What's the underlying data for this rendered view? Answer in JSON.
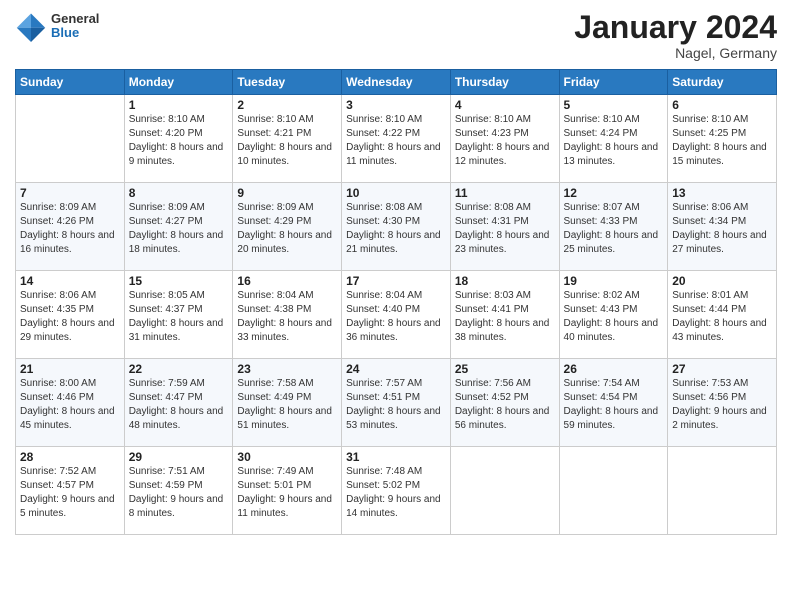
{
  "logo": {
    "general": "General",
    "blue": "Blue"
  },
  "title": "January 2024",
  "location": "Nagel, Germany",
  "days_header": [
    "Sunday",
    "Monday",
    "Tuesday",
    "Wednesday",
    "Thursday",
    "Friday",
    "Saturday"
  ],
  "weeks": [
    [
      {
        "day": "",
        "sunrise": "",
        "sunset": "",
        "daylight": ""
      },
      {
        "day": "1",
        "sunrise": "Sunrise: 8:10 AM",
        "sunset": "Sunset: 4:20 PM",
        "daylight": "Daylight: 8 hours and 9 minutes."
      },
      {
        "day": "2",
        "sunrise": "Sunrise: 8:10 AM",
        "sunset": "Sunset: 4:21 PM",
        "daylight": "Daylight: 8 hours and 10 minutes."
      },
      {
        "day": "3",
        "sunrise": "Sunrise: 8:10 AM",
        "sunset": "Sunset: 4:22 PM",
        "daylight": "Daylight: 8 hours and 11 minutes."
      },
      {
        "day": "4",
        "sunrise": "Sunrise: 8:10 AM",
        "sunset": "Sunset: 4:23 PM",
        "daylight": "Daylight: 8 hours and 12 minutes."
      },
      {
        "day": "5",
        "sunrise": "Sunrise: 8:10 AM",
        "sunset": "Sunset: 4:24 PM",
        "daylight": "Daylight: 8 hours and 13 minutes."
      },
      {
        "day": "6",
        "sunrise": "Sunrise: 8:10 AM",
        "sunset": "Sunset: 4:25 PM",
        "daylight": "Daylight: 8 hours and 15 minutes."
      }
    ],
    [
      {
        "day": "7",
        "sunrise": "Sunrise: 8:09 AM",
        "sunset": "Sunset: 4:26 PM",
        "daylight": "Daylight: 8 hours and 16 minutes."
      },
      {
        "day": "8",
        "sunrise": "Sunrise: 8:09 AM",
        "sunset": "Sunset: 4:27 PM",
        "daylight": "Daylight: 8 hours and 18 minutes."
      },
      {
        "day": "9",
        "sunrise": "Sunrise: 8:09 AM",
        "sunset": "Sunset: 4:29 PM",
        "daylight": "Daylight: 8 hours and 20 minutes."
      },
      {
        "day": "10",
        "sunrise": "Sunrise: 8:08 AM",
        "sunset": "Sunset: 4:30 PM",
        "daylight": "Daylight: 8 hours and 21 minutes."
      },
      {
        "day": "11",
        "sunrise": "Sunrise: 8:08 AM",
        "sunset": "Sunset: 4:31 PM",
        "daylight": "Daylight: 8 hours and 23 minutes."
      },
      {
        "day": "12",
        "sunrise": "Sunrise: 8:07 AM",
        "sunset": "Sunset: 4:33 PM",
        "daylight": "Daylight: 8 hours and 25 minutes."
      },
      {
        "day": "13",
        "sunrise": "Sunrise: 8:06 AM",
        "sunset": "Sunset: 4:34 PM",
        "daylight": "Daylight: 8 hours and 27 minutes."
      }
    ],
    [
      {
        "day": "14",
        "sunrise": "Sunrise: 8:06 AM",
        "sunset": "Sunset: 4:35 PM",
        "daylight": "Daylight: 8 hours and 29 minutes."
      },
      {
        "day": "15",
        "sunrise": "Sunrise: 8:05 AM",
        "sunset": "Sunset: 4:37 PM",
        "daylight": "Daylight: 8 hours and 31 minutes."
      },
      {
        "day": "16",
        "sunrise": "Sunrise: 8:04 AM",
        "sunset": "Sunset: 4:38 PM",
        "daylight": "Daylight: 8 hours and 33 minutes."
      },
      {
        "day": "17",
        "sunrise": "Sunrise: 8:04 AM",
        "sunset": "Sunset: 4:40 PM",
        "daylight": "Daylight: 8 hours and 36 minutes."
      },
      {
        "day": "18",
        "sunrise": "Sunrise: 8:03 AM",
        "sunset": "Sunset: 4:41 PM",
        "daylight": "Daylight: 8 hours and 38 minutes."
      },
      {
        "day": "19",
        "sunrise": "Sunrise: 8:02 AM",
        "sunset": "Sunset: 4:43 PM",
        "daylight": "Daylight: 8 hours and 40 minutes."
      },
      {
        "day": "20",
        "sunrise": "Sunrise: 8:01 AM",
        "sunset": "Sunset: 4:44 PM",
        "daylight": "Daylight: 8 hours and 43 minutes."
      }
    ],
    [
      {
        "day": "21",
        "sunrise": "Sunrise: 8:00 AM",
        "sunset": "Sunset: 4:46 PM",
        "daylight": "Daylight: 8 hours and 45 minutes."
      },
      {
        "day": "22",
        "sunrise": "Sunrise: 7:59 AM",
        "sunset": "Sunset: 4:47 PM",
        "daylight": "Daylight: 8 hours and 48 minutes."
      },
      {
        "day": "23",
        "sunrise": "Sunrise: 7:58 AM",
        "sunset": "Sunset: 4:49 PM",
        "daylight": "Daylight: 8 hours and 51 minutes."
      },
      {
        "day": "24",
        "sunrise": "Sunrise: 7:57 AM",
        "sunset": "Sunset: 4:51 PM",
        "daylight": "Daylight: 8 hours and 53 minutes."
      },
      {
        "day": "25",
        "sunrise": "Sunrise: 7:56 AM",
        "sunset": "Sunset: 4:52 PM",
        "daylight": "Daylight: 8 hours and 56 minutes."
      },
      {
        "day": "26",
        "sunrise": "Sunrise: 7:54 AM",
        "sunset": "Sunset: 4:54 PM",
        "daylight": "Daylight: 8 hours and 59 minutes."
      },
      {
        "day": "27",
        "sunrise": "Sunrise: 7:53 AM",
        "sunset": "Sunset: 4:56 PM",
        "daylight": "Daylight: 9 hours and 2 minutes."
      }
    ],
    [
      {
        "day": "28",
        "sunrise": "Sunrise: 7:52 AM",
        "sunset": "Sunset: 4:57 PM",
        "daylight": "Daylight: 9 hours and 5 minutes."
      },
      {
        "day": "29",
        "sunrise": "Sunrise: 7:51 AM",
        "sunset": "Sunset: 4:59 PM",
        "daylight": "Daylight: 9 hours and 8 minutes."
      },
      {
        "day": "30",
        "sunrise": "Sunrise: 7:49 AM",
        "sunset": "Sunset: 5:01 PM",
        "daylight": "Daylight: 9 hours and 11 minutes."
      },
      {
        "day": "31",
        "sunrise": "Sunrise: 7:48 AM",
        "sunset": "Sunset: 5:02 PM",
        "daylight": "Daylight: 9 hours and 14 minutes."
      },
      {
        "day": "",
        "sunrise": "",
        "sunset": "",
        "daylight": ""
      },
      {
        "day": "",
        "sunrise": "",
        "sunset": "",
        "daylight": ""
      },
      {
        "day": "",
        "sunrise": "",
        "sunset": "",
        "daylight": ""
      }
    ]
  ]
}
